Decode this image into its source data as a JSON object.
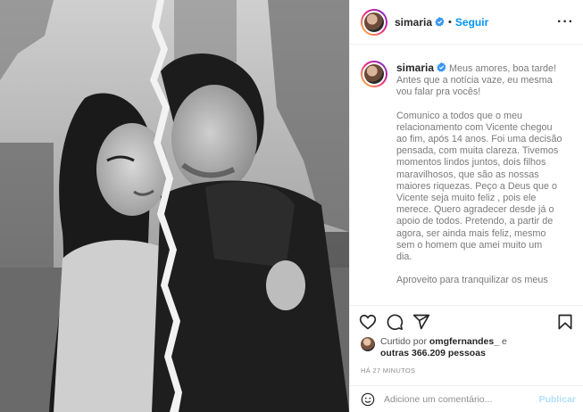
{
  "post": {
    "username": "simaria",
    "follow_label": "Seguir",
    "more_icon": "more-options-icon",
    "caption": {
      "username": "simaria",
      "paragraphs": [
        "Meus amores, boa tarde!\nAntes que a notícia vaze, eu mesma\nvou falar pra vocês!",
        "Comunico a todos que o meu\nrelacionamento com Vicente chegou\nao fim, após 14 anos. Foi uma decisão\npensada, com muita clareza. Tivemos\nmomentos lindos juntos, dois filhos\nmaravilhosos, que são as nossas\nmaiores riquezas. Peço a Deus que o\nVicente seja muito feliz , pois ele\nmerece. Quero agradecer desde já o\napoio de todos. Pretendo, a partir de\nagora, ser ainda mais feliz, mesmo\nsem o homem que amei muito um\ndia.",
        "Aproveito para tranquilizar os meus"
      ]
    },
    "likes": {
      "prefix": "Curtido por",
      "user": "omgfernandes_",
      "middle": "e",
      "others": "outras 366.209 pessoas"
    },
    "time": "HÁ 27 MINUTOS",
    "comment": {
      "placeholder": "Adicione um comentário...",
      "publish_label": "Publicar"
    },
    "colors": {
      "accent": "#0095f6",
      "publish_disabled": "#b2dffc",
      "verified": "#3897f0"
    }
  }
}
